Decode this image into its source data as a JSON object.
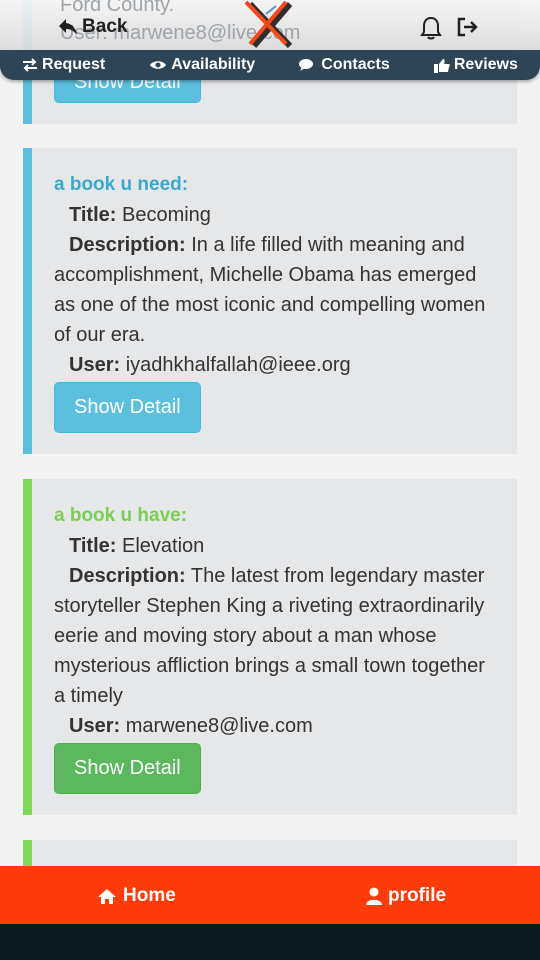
{
  "header": {
    "partial_top_text": "Ford County.",
    "partial_user_text": "User: marwene8@live.com",
    "back_label": "Back"
  },
  "tabs": [
    {
      "label": "Request",
      "icon": "exchange-icon"
    },
    {
      "label": "Availability",
      "icon": "eye-icon"
    },
    {
      "label": "Contacts",
      "icon": "comments-icon"
    },
    {
      "label": "Reviews",
      "icon": "thumbs-up-icon"
    }
  ],
  "partial_card": {
    "button_label": "Show Detail"
  },
  "cards": [
    {
      "heading": "a book u need:",
      "title_label": "Title:",
      "title": "Becoming",
      "description_label": "Description:",
      "description": "In a life filled with meaning and accomplishment, Michelle Obama has emerged as one of the most iconic and compelling women of our era.",
      "user_label": "User:",
      "user": "iyadhkhalfallah@ieee.org",
      "button_label": "Show Detail",
      "accent": "#5bc0de"
    },
    {
      "heading": "a book u have:",
      "title_label": "Title:",
      "title": "Elevation",
      "description_label": "Description:",
      "description": "The latest from legendary master storyteller Stephen King a riveting extraordinarily eerie and moving story about a man whose mysterious affliction brings a small town together a timely",
      "user_label": "User:",
      "user": "marwene8@live.com",
      "button_label": "Show Detail",
      "accent": "#7ed956"
    }
  ],
  "footer": {
    "home_label": "Home",
    "profile_label": "profile",
    "color": "#ff3b09"
  }
}
